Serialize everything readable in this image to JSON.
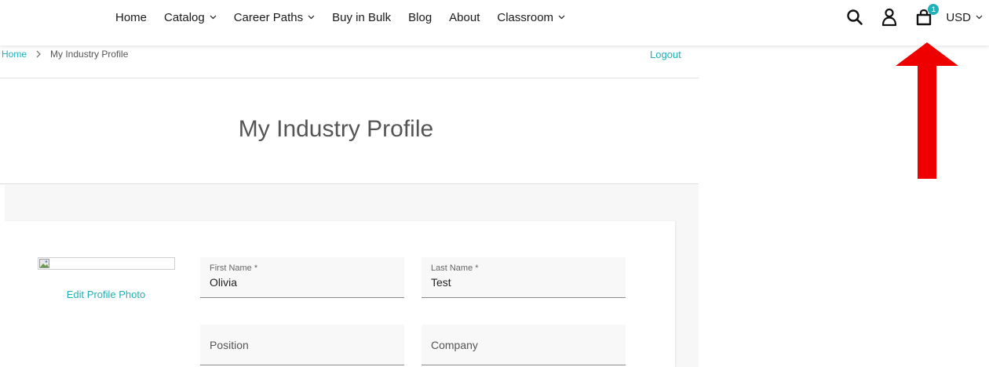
{
  "nav": {
    "items": [
      {
        "label": "Home",
        "dropdown": false
      },
      {
        "label": "Catalog",
        "dropdown": true
      },
      {
        "label": "Career Paths",
        "dropdown": true
      },
      {
        "label": "Buy in Bulk",
        "dropdown": false
      },
      {
        "label": "Blog",
        "dropdown": false
      },
      {
        "label": "About",
        "dropdown": false
      },
      {
        "label": "Classroom",
        "dropdown": true
      }
    ]
  },
  "header": {
    "icons": [
      "search-icon",
      "account-icon",
      "cart-icon"
    ],
    "cart_count": "1",
    "currency": "USD"
  },
  "breadcrumb": {
    "home": "Home",
    "current": "My Industry Profile"
  },
  "logout_label": "Logout",
  "page_title": "My Industry Profile",
  "profile": {
    "edit_photo_label": "Edit Profile Photo",
    "first_name": {
      "label": "First Name *",
      "value": "Olivia"
    },
    "last_name": {
      "label": "Last Name *",
      "value": "Test"
    },
    "position": {
      "placeholder": "Position"
    },
    "company": {
      "placeholder": "Company"
    }
  },
  "colors": {
    "accent": "#20b0b8",
    "annotation_arrow": "#ee0000"
  }
}
